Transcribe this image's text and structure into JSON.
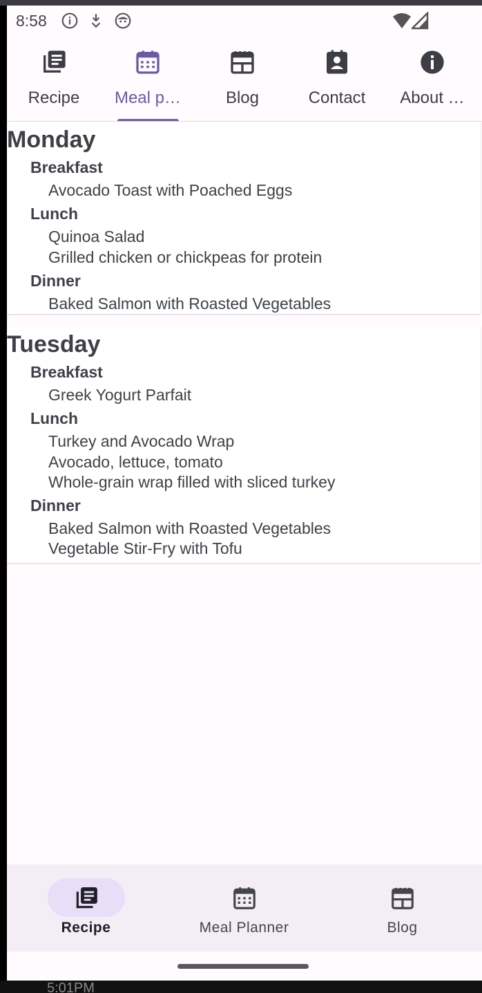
{
  "status_bar": {
    "time": "8:58",
    "icons": [
      "info-icon",
      "download-arrow-icon",
      "face-icon",
      "wifi-icon",
      "signal-icon"
    ]
  },
  "top_tabs": [
    {
      "label": "Recipe",
      "icon": "article-icon",
      "active": false
    },
    {
      "label": "Meal p…",
      "icon": "calendar-icon",
      "active": true
    },
    {
      "label": "Blog",
      "icon": "newspaper-icon",
      "active": false
    },
    {
      "label": "Contact",
      "icon": "contact-card-icon",
      "active": false
    },
    {
      "label": "About …",
      "icon": "info-icon",
      "active": false
    }
  ],
  "days": [
    {
      "name": "Monday",
      "meals": [
        {
          "label": "Breakfast",
          "items": [
            "Avocado Toast with Poached Eggs"
          ]
        },
        {
          "label": "Lunch",
          "items": [
            "Quinoa Salad",
            "Grilled chicken or chickpeas for protein"
          ]
        },
        {
          "label": "Dinner",
          "items": [
            "Baked Salmon with Roasted Vegetables"
          ]
        }
      ]
    },
    {
      "name": "Tuesday",
      "meals": [
        {
          "label": "Breakfast",
          "items": [
            "Greek Yogurt Parfait"
          ]
        },
        {
          "label": "Lunch",
          "items": [
            "Turkey and Avocado Wrap",
            "Avocado, lettuce, tomato",
            "Whole-grain wrap filled with sliced turkey"
          ]
        },
        {
          "label": "Dinner",
          "items": [
            "Baked Salmon with Roasted Vegetables",
            "Vegetable Stir-Fry with Tofu"
          ]
        }
      ]
    }
  ],
  "bottom_nav": [
    {
      "label": "Recipe",
      "icon": "article-icon",
      "active": true
    },
    {
      "label": "Meal Planner",
      "icon": "calendar-icon",
      "active": false
    },
    {
      "label": "Blog",
      "icon": "newspaper-icon",
      "active": false
    }
  ],
  "behind_text": "5:01PM",
  "colors": {
    "accent": "#6a5aa6",
    "nav_background": "#f3edf6",
    "pill": "#e8def8"
  }
}
